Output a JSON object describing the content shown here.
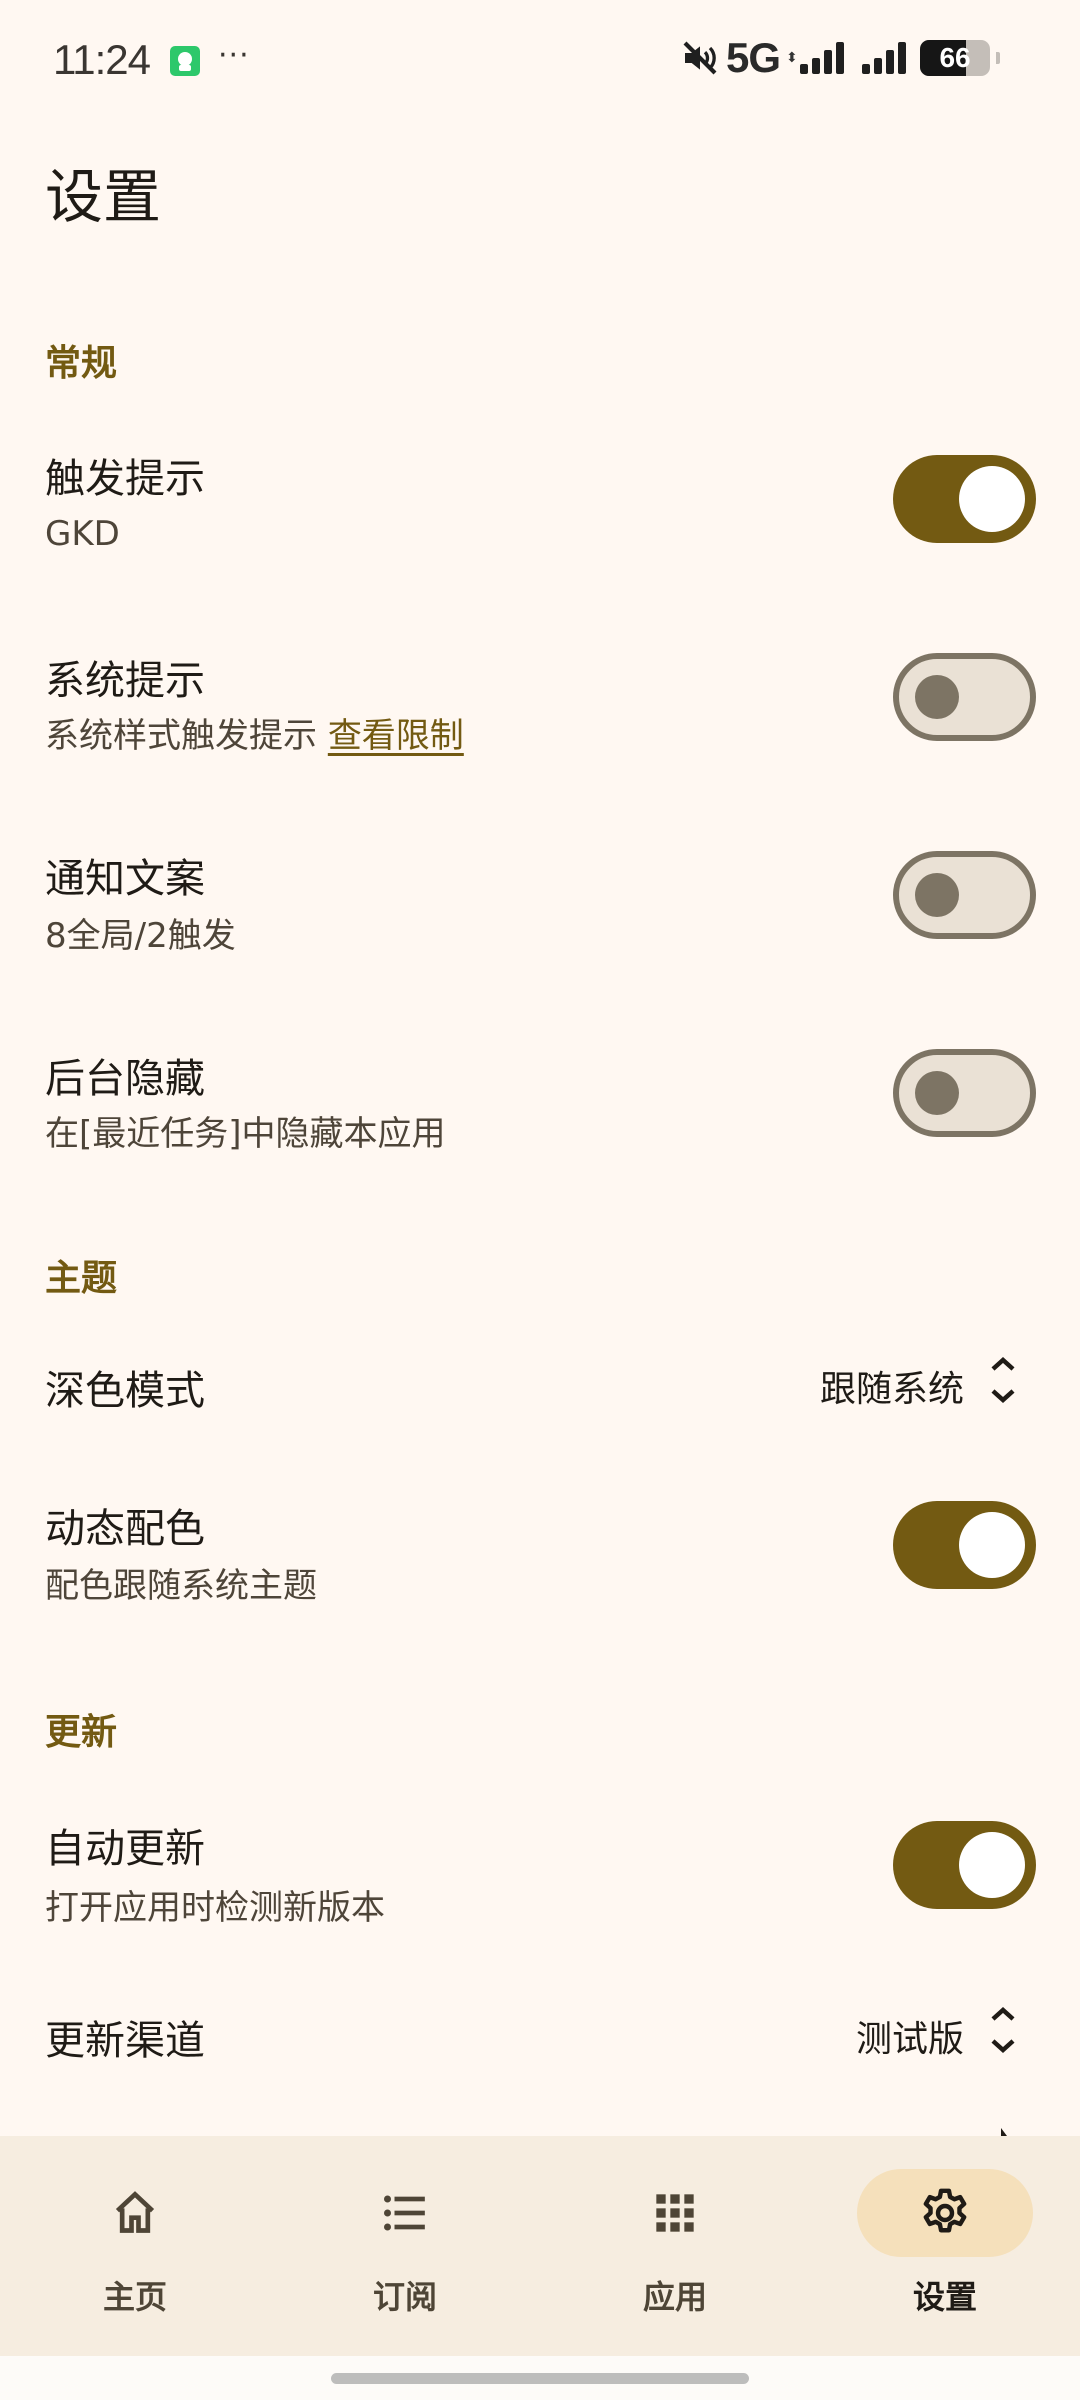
{
  "status_bar": {
    "time": "11:24",
    "notification_icon": "chat-app-icon",
    "more_indicator": "···",
    "mute_icon": "vibrate-muted-icon",
    "network": "5G",
    "battery_level": 66,
    "battery_text": "66"
  },
  "page": {
    "title": "设置"
  },
  "sections": {
    "general": {
      "label": "常规",
      "trigger_hint": {
        "title": "触发提示",
        "subtitle": "GKD",
        "enabled": true
      },
      "system_hint": {
        "title": "系统提示",
        "subtitle": "系统样式触发提示",
        "link": "查看限制",
        "enabled": false
      },
      "notification_text": {
        "title": "通知文案",
        "subtitle": "8全局/2触发",
        "enabled": false
      },
      "hide_background": {
        "title": "后台隐藏",
        "subtitle": "在[最近任务]中隐藏本应用",
        "enabled": false
      }
    },
    "theme": {
      "label": "主题",
      "dark_mode": {
        "title": "深色模式",
        "value": "跟随系统"
      },
      "dynamic_color": {
        "title": "动态配色",
        "subtitle": "配色跟随系统主题",
        "enabled": true
      }
    },
    "update": {
      "label": "更新",
      "auto_update": {
        "title": "自动更新",
        "subtitle": "打开应用时检测新版本",
        "enabled": true
      },
      "channel": {
        "title": "更新渠道",
        "value": "测试版"
      }
    }
  },
  "bottom_nav": {
    "items": [
      {
        "label": "主页",
        "icon": "home-icon",
        "active": false
      },
      {
        "label": "订阅",
        "icon": "list-icon",
        "active": false
      },
      {
        "label": "应用",
        "icon": "apps-grid-icon",
        "active": false
      },
      {
        "label": "设置",
        "icon": "gear-icon",
        "active": true
      }
    ]
  },
  "colors": {
    "background": "#FFF8F2",
    "accent": "#735A12",
    "nav_background": "#F6EDE0",
    "nav_active_pill": "#F5E0BB",
    "switch_off_track": "#EAE1D5",
    "switch_off_outline": "#7D7464"
  }
}
